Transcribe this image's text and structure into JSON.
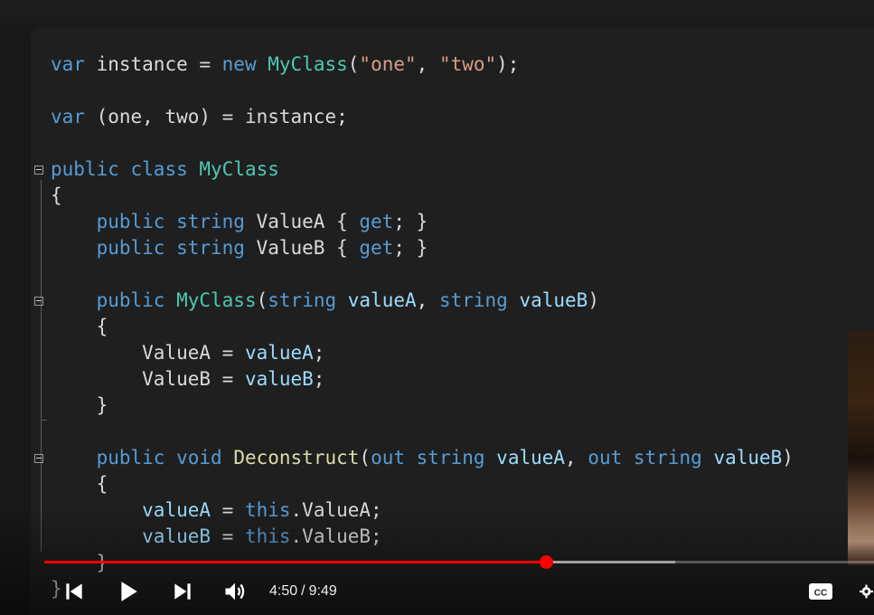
{
  "code": {
    "lines": [
      [
        {
          "t": "var",
          "c": "kw"
        },
        {
          "t": " instance = ",
          "c": "pl"
        },
        {
          "t": "new",
          "c": "kw"
        },
        {
          "t": " ",
          "c": "pl"
        },
        {
          "t": "MyClass",
          "c": "ty"
        },
        {
          "t": "(",
          "c": "pl"
        },
        {
          "t": "\"one\"",
          "c": "st"
        },
        {
          "t": ", ",
          "c": "pl"
        },
        {
          "t": "\"two\"",
          "c": "st"
        },
        {
          "t": ");",
          "c": "pl"
        }
      ],
      [],
      [
        {
          "t": "var",
          "c": "kw"
        },
        {
          "t": " (one, two) = instance;",
          "c": "pl"
        }
      ],
      [],
      [
        {
          "t": "public",
          "c": "kw"
        },
        {
          "t": " ",
          "c": "pl"
        },
        {
          "t": "class",
          "c": "kw"
        },
        {
          "t": " ",
          "c": "pl"
        },
        {
          "t": "MyClass",
          "c": "ty"
        }
      ],
      [
        {
          "t": "{",
          "c": "pl"
        }
      ],
      [
        {
          "t": "    ",
          "c": "pl"
        },
        {
          "t": "public",
          "c": "kw"
        },
        {
          "t": " ",
          "c": "pl"
        },
        {
          "t": "string",
          "c": "kw"
        },
        {
          "t": " ValueA { ",
          "c": "pl"
        },
        {
          "t": "get",
          "c": "kw"
        },
        {
          "t": "; }",
          "c": "pl"
        }
      ],
      [
        {
          "t": "    ",
          "c": "pl"
        },
        {
          "t": "public",
          "c": "kw"
        },
        {
          "t": " ",
          "c": "pl"
        },
        {
          "t": "string",
          "c": "kw"
        },
        {
          "t": " ValueB { ",
          "c": "pl"
        },
        {
          "t": "get",
          "c": "kw"
        },
        {
          "t": "; }",
          "c": "pl"
        }
      ],
      [],
      [
        {
          "t": "    ",
          "c": "pl"
        },
        {
          "t": "public",
          "c": "kw"
        },
        {
          "t": " ",
          "c": "pl"
        },
        {
          "t": "MyClass",
          "c": "ty"
        },
        {
          "t": "(",
          "c": "pl"
        },
        {
          "t": "string",
          "c": "kw"
        },
        {
          "t": " ",
          "c": "pl"
        },
        {
          "t": "valueA",
          "c": "va"
        },
        {
          "t": ", ",
          "c": "pl"
        },
        {
          "t": "string",
          "c": "kw"
        },
        {
          "t": " ",
          "c": "pl"
        },
        {
          "t": "valueB",
          "c": "va"
        },
        {
          "t": ")",
          "c": "pl"
        }
      ],
      [
        {
          "t": "    {",
          "c": "pl"
        }
      ],
      [
        {
          "t": "        ValueA = ",
          "c": "pl"
        },
        {
          "t": "valueA",
          "c": "va"
        },
        {
          "t": ";",
          "c": "pl"
        }
      ],
      [
        {
          "t": "        ValueB = ",
          "c": "pl"
        },
        {
          "t": "valueB",
          "c": "va"
        },
        {
          "t": ";",
          "c": "pl"
        }
      ],
      [
        {
          "t": "    }",
          "c": "pl"
        }
      ],
      [],
      [
        {
          "t": "    ",
          "c": "pl"
        },
        {
          "t": "public",
          "c": "kw"
        },
        {
          "t": " ",
          "c": "pl"
        },
        {
          "t": "void",
          "c": "kw"
        },
        {
          "t": " ",
          "c": "pl"
        },
        {
          "t": "Deconstruct",
          "c": "fn"
        },
        {
          "t": "(",
          "c": "pl"
        },
        {
          "t": "out",
          "c": "kw"
        },
        {
          "t": " ",
          "c": "pl"
        },
        {
          "t": "string",
          "c": "kw"
        },
        {
          "t": " ",
          "c": "pl"
        },
        {
          "t": "valueA",
          "c": "va"
        },
        {
          "t": ", ",
          "c": "pl"
        },
        {
          "t": "out",
          "c": "kw"
        },
        {
          "t": " ",
          "c": "pl"
        },
        {
          "t": "string",
          "c": "kw"
        },
        {
          "t": " ",
          "c": "pl"
        },
        {
          "t": "valueB",
          "c": "va"
        },
        {
          "t": ")",
          "c": "pl"
        }
      ],
      [
        {
          "t": "    {",
          "c": "pl"
        }
      ],
      [
        {
          "t": "        ",
          "c": "pl"
        },
        {
          "t": "valueA",
          "c": "va"
        },
        {
          "t": " = ",
          "c": "pl"
        },
        {
          "t": "this",
          "c": "kw"
        },
        {
          "t": ".ValueA;",
          "c": "pl"
        }
      ],
      [
        {
          "t": "        ",
          "c": "pl"
        },
        {
          "t": "valueB",
          "c": "va"
        },
        {
          "t": " = ",
          "c": "pl"
        },
        {
          "t": "this",
          "c": "kw"
        },
        {
          "t": ".ValueB;",
          "c": "pl"
        }
      ],
      [
        {
          "t": "    }",
          "c": "pl"
        }
      ],
      [
        {
          "t": "}",
          "c": "pl"
        }
      ]
    ]
  },
  "player": {
    "current_time": "4:50",
    "separator": "/",
    "duration": "9:49",
    "progress_fraction": 0.605,
    "buffered_fraction": 0.76,
    "accent_color": "#ff0000",
    "icons": {
      "previous": "skip-previous-icon",
      "play": "play-icon",
      "next": "skip-next-icon",
      "volume": "volume-icon",
      "captions": "captions-icon",
      "settings": "gear-icon"
    }
  },
  "colors": {
    "keyword": "#569cd6",
    "type": "#4ec9b0",
    "string": "#d69d85",
    "method": "#dcdcaa",
    "parameter": "#9cdcfe",
    "plain": "#dadada",
    "editor_bg": "#1f1f1f"
  }
}
